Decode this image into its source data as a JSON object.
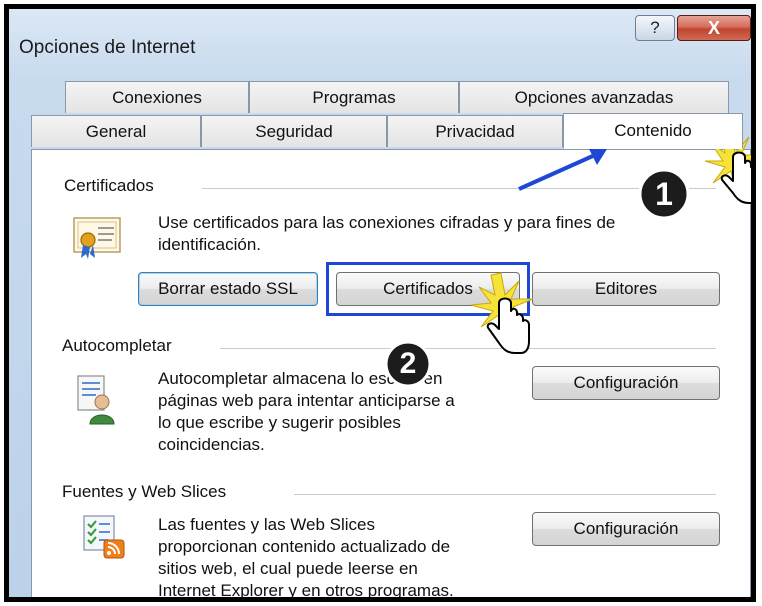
{
  "window": {
    "title": "Opciones de Internet",
    "help_label": "?",
    "close_label": "X"
  },
  "tabs": {
    "back": [
      {
        "label": "Conexiones"
      },
      {
        "label": "Programas"
      },
      {
        "label": "Opciones avanzadas"
      }
    ],
    "front": [
      {
        "label": "General"
      },
      {
        "label": "Seguridad"
      },
      {
        "label": "Privacidad"
      },
      {
        "label": "Contenido",
        "active": true
      }
    ]
  },
  "sections": {
    "certificados": {
      "title": "Certificados",
      "desc_line1": "Use certificados para las conexiones cifradas y para fines de",
      "desc_line2": "identificación.",
      "buttons": {
        "clear_ssl": "Borrar estado SSL",
        "certificates": "Certificados",
        "publishers": "Editores"
      }
    },
    "autocompletar": {
      "title": "Autocompletar",
      "lines": [
        "Autocompletar almacena lo escrito en",
        "páginas web para intentar anticiparse a",
        "lo que escribe y sugerir posibles",
        "coincidencias."
      ],
      "button": "Configuración"
    },
    "fuentes": {
      "title": "Fuentes y Web Slices",
      "lines": [
        "Las fuentes y las Web Slices",
        "proporcionan contenido actualizado de",
        "sitios web, el cual puede leerse en",
        "Internet Explorer y en otros programas."
      ],
      "button": "Configuración"
    }
  },
  "annotations": {
    "step1": "1",
    "step2": "2"
  },
  "colors": {
    "highlight": "#1f47d6",
    "arrow": "#1f47d6",
    "close": "#c0452f"
  },
  "icons": [
    "certificate-icon",
    "autocomplete-user-icon",
    "feeds-icon",
    "hand-cursor-icon"
  ]
}
